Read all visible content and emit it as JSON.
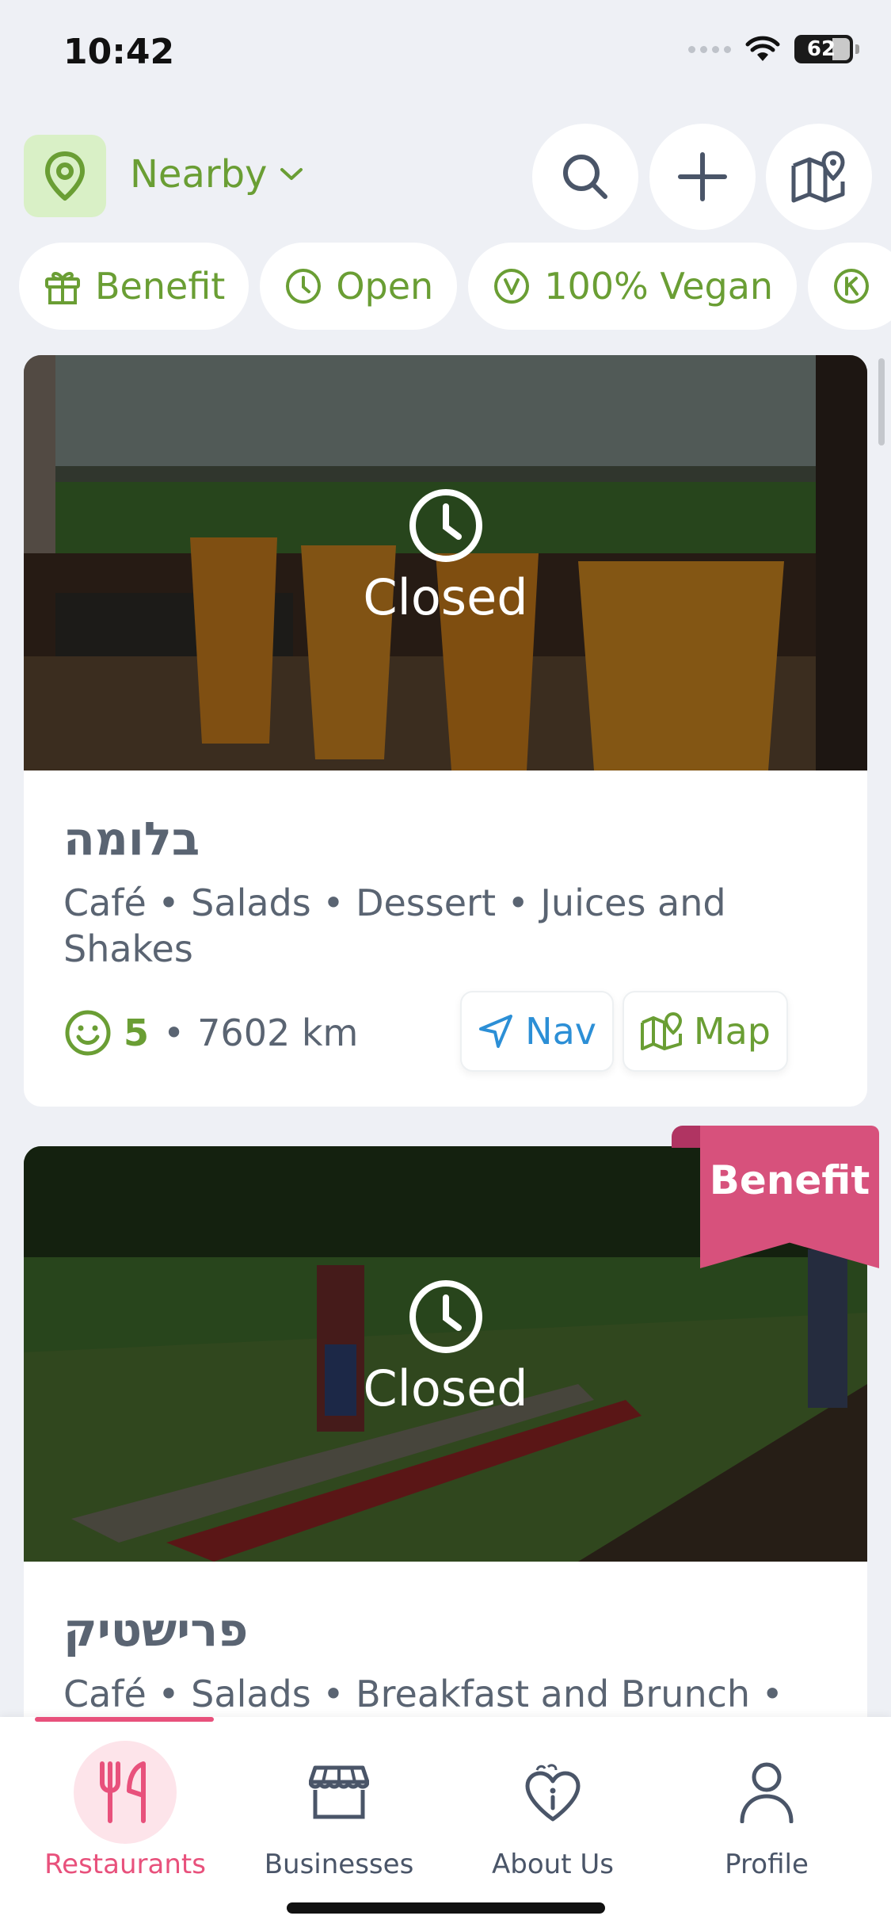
{
  "status_bar": {
    "time": "10:42",
    "battery": "62"
  },
  "header": {
    "location_label": "Nearby"
  },
  "filters": [
    {
      "label": "Benefit",
      "icon": "gift-icon"
    },
    {
      "label": "Open",
      "icon": "clock-icon"
    },
    {
      "label": "100% Vegan",
      "icon": "vegan-icon"
    },
    {
      "label": "",
      "icon": "kosher-icon"
    }
  ],
  "restaurants": [
    {
      "name": "בלומה",
      "tags": "Café • Salads • Dessert • Juices and Shakes",
      "status": "Closed",
      "rating": "5",
      "distance": "7602 km",
      "nav_label": "Nav",
      "map_label": "Map",
      "benefit": false
    },
    {
      "name": "פרישטיק",
      "tags": "Café • Salads • Breakfast and Brunch •",
      "status": "Closed",
      "benefit": true,
      "benefit_label": "Benefit"
    }
  ],
  "tabs": [
    {
      "label": "Restaurants",
      "icon": "fork-knife-icon",
      "active": true
    },
    {
      "label": "Businesses",
      "icon": "store-icon",
      "active": false
    },
    {
      "label": "About Us",
      "icon": "heart-info-icon",
      "active": false
    },
    {
      "label": "Profile",
      "icon": "person-icon",
      "active": false
    }
  ],
  "colors": {
    "brand_green": "#6a9e34",
    "accent_pink": "#e8517c",
    "nav_blue": "#2c8fd6"
  }
}
